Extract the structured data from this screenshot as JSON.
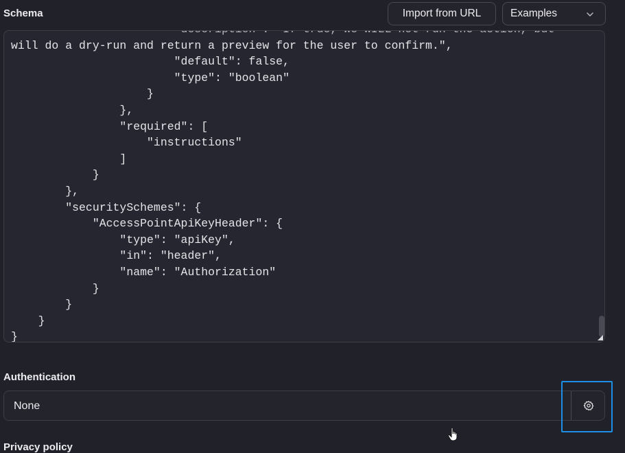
{
  "schema": {
    "label": "Schema",
    "import_button": "Import from URL",
    "examples_select": "Examples",
    "code_lines": [
      "                        \"description\": \"If true, we WILL not run the action, but",
      "will do a dry-run and return a preview for the user to confirm.\",",
      "                        \"default\": false,",
      "                        \"type\": \"boolean\"",
      "                    }",
      "                },",
      "                \"required\": [",
      "                    \"instructions\"",
      "                ]",
      "            }",
      "        },",
      "        \"securitySchemes\": {",
      "            \"AccessPointApiKeyHeader\": {",
      "                \"type\": \"apiKey\",",
      "                \"in\": \"header\",",
      "                \"name\": \"Authorization\"",
      "            }",
      "        }",
      "    }",
      "}"
    ]
  },
  "authentication": {
    "label": "Authentication",
    "value": "None",
    "settings_icon": "gear-icon"
  },
  "privacy": {
    "label": "Privacy policy"
  },
  "colors": {
    "background": "#212129",
    "focus": "#1f8fe6"
  }
}
